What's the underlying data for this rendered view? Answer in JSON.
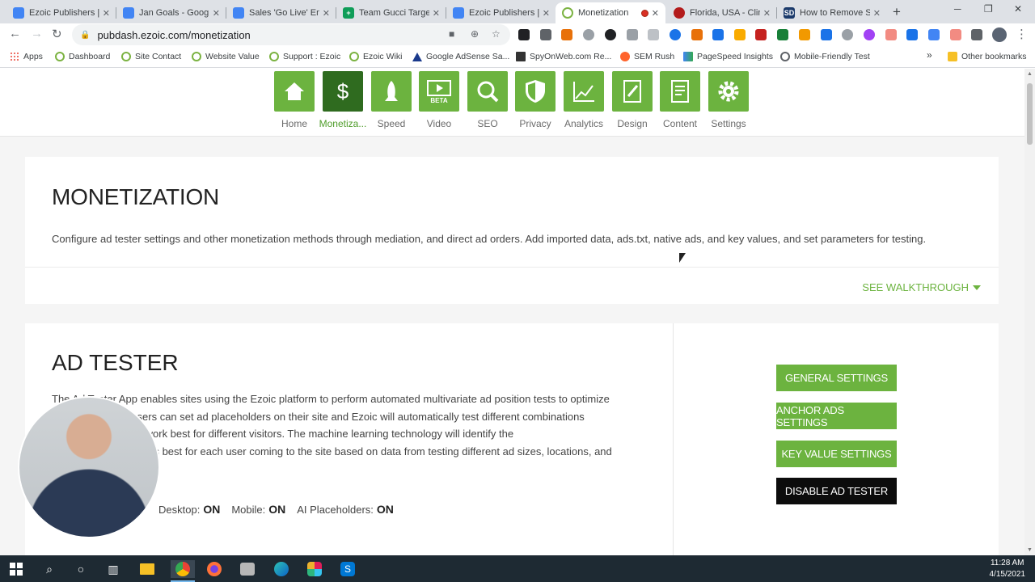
{
  "browser": {
    "tabs": [
      {
        "title": "Ezoic Publishers | C",
        "color": "#4285f4",
        "active": false
      },
      {
        "title": "Jan Goals - Google",
        "color": "#4285f4",
        "active": false
      },
      {
        "title": "Sales 'Go Live' Ema",
        "color": "#4285f4",
        "active": false
      },
      {
        "title": "Team Gucci Target",
        "color": "#0f9d58",
        "active": false
      },
      {
        "title": "Ezoic Publishers | C",
        "color": "#4285f4",
        "active": false
      },
      {
        "title": "Monetization",
        "color": "#7cb342",
        "active": true
      },
      {
        "title": "Florida, USA - Clim",
        "color": "#b31b1b",
        "active": false
      },
      {
        "title": "How to Remove S",
        "color": "#1b3a6b",
        "active": false
      }
    ],
    "url": "pubdash.ezoic.com/monetization",
    "bookmarks": [
      {
        "label": "Apps",
        "icon": "apps-icon"
      },
      {
        "label": "Dashboard",
        "icon": "ezoic-icon"
      },
      {
        "label": "Site Contact",
        "icon": "ezoic-icon"
      },
      {
        "label": "Website Value",
        "icon": "ezoic-icon"
      },
      {
        "label": "Support : Ezoic",
        "icon": "ezoic-icon"
      },
      {
        "label": "Ezoic Wiki",
        "icon": "ezoic-icon"
      },
      {
        "label": "Google AdSense Sa...",
        "icon": "adsense-icon"
      },
      {
        "label": "SpyOnWeb.com Re...",
        "icon": "spyonweb-icon"
      },
      {
        "label": "SEM Rush",
        "icon": "semrush-icon"
      },
      {
        "label": "PageSpeed Insights",
        "icon": "pagespeed-icon"
      },
      {
        "label": "Mobile-Friendly Test",
        "icon": "mobile-test-icon"
      }
    ],
    "bookmarks_overflow": "»",
    "other_bookmarks": "Other bookmarks"
  },
  "nav": {
    "items": [
      {
        "label": "Home",
        "icon": "home-icon",
        "active": false
      },
      {
        "label": "Monetiza...",
        "icon": "dollar-icon",
        "active": true
      },
      {
        "label": "Speed",
        "icon": "rocket-icon",
        "active": false
      },
      {
        "label": "Video",
        "icon": "video-icon",
        "active": false
      },
      {
        "label": "SEO",
        "icon": "magnifier-icon",
        "active": false
      },
      {
        "label": "Privacy",
        "icon": "shield-icon",
        "active": false
      },
      {
        "label": "Analytics",
        "icon": "chart-icon",
        "active": false
      },
      {
        "label": "Design",
        "icon": "design-icon",
        "active": false
      },
      {
        "label": "Content",
        "icon": "content-icon",
        "active": false
      },
      {
        "label": "Settings",
        "icon": "gear-icon",
        "active": false
      }
    ],
    "video_badge": "BETA"
  },
  "monetization": {
    "title": "MONETIZATION",
    "description": "Configure ad tester settings and other monetization methods through mediation, and direct ad orders. Add imported data, ads.txt, native ads, and key values, and set parameters for testing.",
    "walkthrough": "SEE WALKTHROUGH"
  },
  "ad_tester": {
    "title": "AD TESTER",
    "description_lines": [
      "The Ad Tester App enables sites using the Ezoic platform to perform automated multivariate ad position tests to optimize",
      "ad revenue. App users can set ad placeholders on their site and Ezoic will automatically test different combinations",
      "to learn which ones work best for different visitors. The machine learning technology will identify the",
      "combination that works best for each user coming to the site based on data from testing different ad sizes, locations, and"
    ],
    "toggles": [
      {
        "label": "Desktop:",
        "value": "ON"
      },
      {
        "label": "Mobile:",
        "value": "ON"
      },
      {
        "label": "AI Placeholders:",
        "value": "ON"
      }
    ],
    "buttons": {
      "general": "GENERAL SETTINGS",
      "anchor": "ANCHOR ADS SETTINGS",
      "key_value": "KEY VALUE SETTINGS",
      "disable": "DISABLE AD TESTER"
    }
  },
  "taskbar": {
    "time": "11:28 AM",
    "date": "4/15/2021"
  }
}
